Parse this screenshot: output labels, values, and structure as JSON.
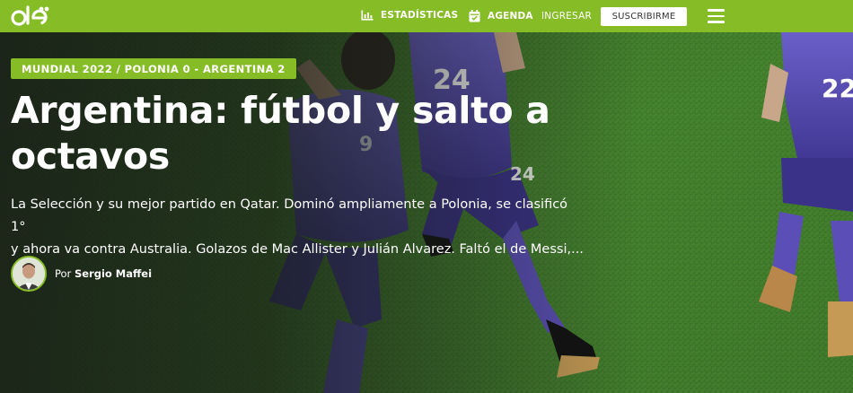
{
  "header": {
    "logo_text": "olé",
    "logo_icon": "ole-logo-icon",
    "nav": {
      "stats_label": "ESTADÍSTICAS",
      "stats_icon": "bar-chart-icon",
      "agenda_label": "AGENDA",
      "agenda_icon": "calendar-icon",
      "login_label": "INGRESAR",
      "subscribe_label": "SUSCRIBIRME",
      "menu_icon": "hamburger-menu-icon"
    }
  },
  "article": {
    "kicker": "MUNDIAL 2022 / POLONIA 0 - ARGENTINA 2",
    "headline_line1": "Argentina: fútbol y salto a",
    "headline_line2": "octavos",
    "summary_line1": "La Selección y su mejor partido en Qatar. Dominó ampliamente a Polonia, se clasificó 1°",
    "summary_line2": "y ahora va contra Australia. Golazos de Mac Allister y Julián Alvarez. Faltó el de Messi,...",
    "byline_prefix": "Por",
    "author": "Sergio Maffei"
  },
  "photo": {
    "jersey_numbers": [
      "9",
      "24",
      "24",
      "22"
    ]
  },
  "colors": {
    "brand_green": "#86bc25",
    "pitch_green": "#3f7a2c",
    "kit_purple": "#5a4fb5",
    "white": "#ffffff"
  }
}
